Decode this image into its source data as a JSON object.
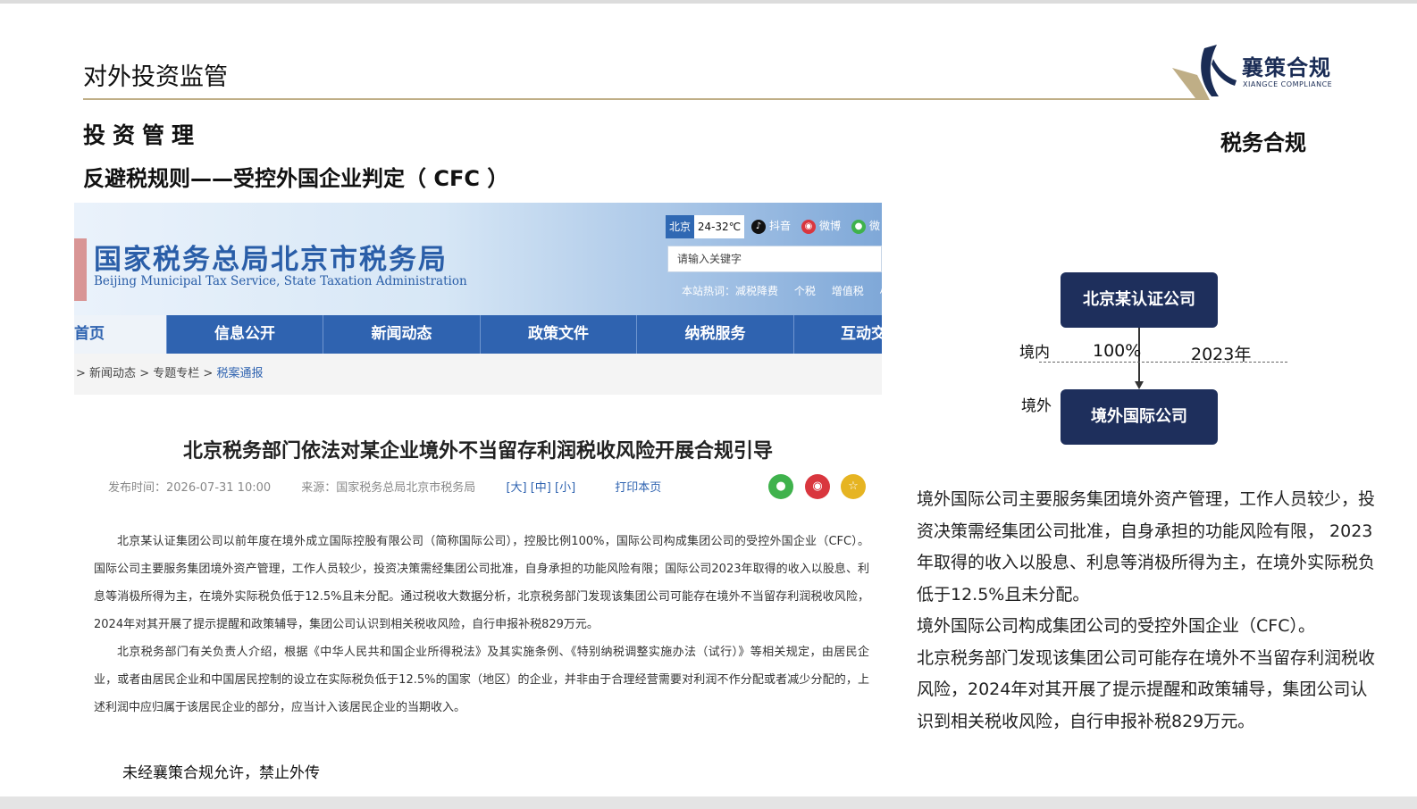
{
  "slide": {
    "title": "对外投资监管",
    "section_heading": "投资管理",
    "subsection_heading": "反避税规则——受控外国企业判定（ CFC ）",
    "right_tag": "税务合规",
    "footer_note": "未经襄策合规允许，禁止外传"
  },
  "logo": {
    "name_cn": "襄策合规",
    "name_en": "XIANGCE COMPLIANCE",
    "colors": {
      "navy": "#1a2c55",
      "gold": "#bfae86"
    }
  },
  "screenshot": {
    "site_name": "国家税务总局北京市税务局",
    "site_name_en": "Beijing Municipal Tax Service, State Taxation Administration",
    "weather_city": "北京",
    "weather_temp": "24-32℃",
    "social": [
      "抖音",
      "微博",
      "微"
    ],
    "search_placeholder": "请输入关键字",
    "hot_label": "本站热词：",
    "hot_items": [
      "减税降费",
      "个税",
      "增值税",
      "小微"
    ],
    "nav": [
      "首页",
      "信息公开",
      "新闻动态",
      "政策文件",
      "纳税服务",
      "互动交"
    ],
    "breadcrumb": [
      ">",
      "新闻动态",
      ">",
      "专题专栏",
      ">",
      "税案通报"
    ],
    "article_title": "北京税务部门依法对某企业境外不当留存利润税收风险开展合规引导",
    "meta": {
      "publish_time": "发布时间：2026-07-31 10:00",
      "source": "来源：国家税务总局北京市税务局",
      "font_sizes": "[大] [中] [小]",
      "print": "打印本页"
    },
    "paragraphs": [
      "北京某认证集团公司以前年度在境外成立国际控股有限公司（简称国际公司），控股比例100%，国际公司构成集团公司的受控外国企业（CFC）。国际公司主要服务集团境外资产管理，工作人员较少，投资决策需经集团公司批准，自身承担的功能风险有限；国际公司2023年取得的收入以股息、利息等消极所得为主，在境外实际税负低于12.5%且未分配。通过税收大数据分析，北京税务部门发现该集团公司可能存在境外不当留存利润税收风险，2024年对其开展了提示提醒和政策辅导，集团公司认识到相关税收风险，自行申报补税829万元。",
      "北京税务部门有关负责人介绍，根据《中华人民共和国企业所得税法》及其实施条例、《特别纳税调整实施办法（试行）》等相关规定，由居民企业，或者由居民企业和中国居民控制的设立在实际税负低于12.5%的国家（地区）的企业，并非由于合理经营需要对利润不作分配或者减少分配的，上述利润中应归属于该居民企业的部分，应当计入该居民企业的当期收入。"
    ]
  },
  "diagram": {
    "top_entity": "北京某认证公司",
    "bottom_entity": "境外国际公司",
    "label_domestic": "境内",
    "label_abroad": "境外",
    "ownership": "100%",
    "year": "2023年"
  },
  "summary": [
    "境外国际公司主要服务集团境外资产管理，工作人员较少，投资决策需经集团公司批准，自身承担的功能风险有限， 2023年取得的收入以股息、利息等消极所得为主，在境外实际税负低于12.5%且未分配。",
    "境外国际公司构成集团公司的受控外国企业（CFC）。",
    "北京税务部门发现该集团公司可能存在境外不当留存利润税收风险，2024年对其开展了提示提醒和政策辅导，集团公司认识到相关税收风险，自行申报补税829万元。"
  ]
}
